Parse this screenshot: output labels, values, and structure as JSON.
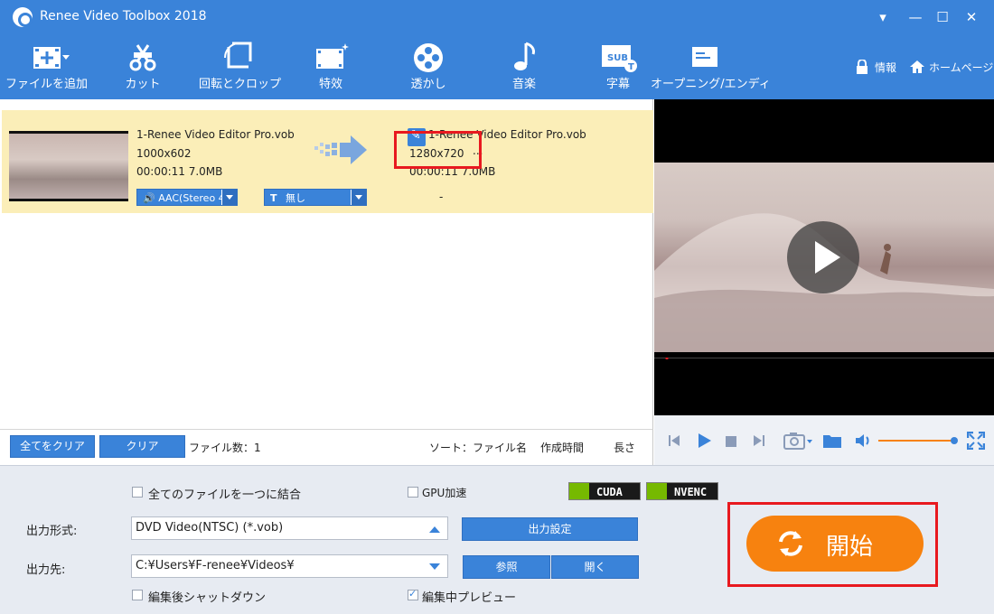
{
  "app": {
    "title": "Renee Video Toolbox 2018"
  },
  "window": {
    "min": "▾",
    "minimize": "—",
    "maximize": "☐",
    "close": "✕"
  },
  "toolbar": {
    "items": [
      {
        "label": "ファイルを追加",
        "icon": "add-file-icon"
      },
      {
        "label": "カット",
        "icon": "cut-icon"
      },
      {
        "label": "回転とクロップ",
        "icon": "rotate-crop-icon"
      },
      {
        "label": "特效",
        "icon": "effects-icon"
      },
      {
        "label": "透かし",
        "icon": "watermark-icon"
      },
      {
        "label": "音楽",
        "icon": "music-icon"
      },
      {
        "label": "字幕",
        "icon": "subtitle-icon"
      },
      {
        "label": "オープニング/エンディ",
        "icon": "opening-ending-icon"
      }
    ],
    "info": "情報",
    "home": "ホームページ"
  },
  "file": {
    "src_name": "1-Renee Video Editor Pro.vob",
    "src_res": "1000x602",
    "src_meta": "00:00:11  7.0MB",
    "dst_name": "1-Renee Video Editor Pro.vob",
    "dst_res": "1280x720",
    "dst_more": "...",
    "dst_meta": "00:00:11  7.0MB",
    "audio": "AAC(Stereo 4",
    "subtitle": "無し",
    "dash": "-"
  },
  "listbar": {
    "clear_all": "全てをクリア",
    "clear": "クリア",
    "file_count": "ファイル数：1",
    "sort_label": "ソート：ファイル名",
    "sort_time": "作成時間",
    "sort_len": "長さ"
  },
  "settings": {
    "merge_label": "全てのファイルを一つに結合",
    "gpu_label": "GPU加速",
    "cuda": "CUDA",
    "nvenc": "NVENC",
    "format_label": "出力形式:",
    "format_value": "DVD Video(NTSC) (*.vob)",
    "output_settings": "出力設定",
    "dest_label": "出力先:",
    "dest_value": "C:¥Users¥F-renee¥Videos¥",
    "browse": "参照",
    "open": "開く",
    "shutdown_label": "編集後シャットダウン",
    "preview_label": "編集中プレビュー",
    "start": "開始"
  },
  "colors": {
    "accent": "#3a83d9",
    "start": "#f7820f",
    "highlight_row": "#fbeeb8",
    "annotation": "#e8191f"
  }
}
